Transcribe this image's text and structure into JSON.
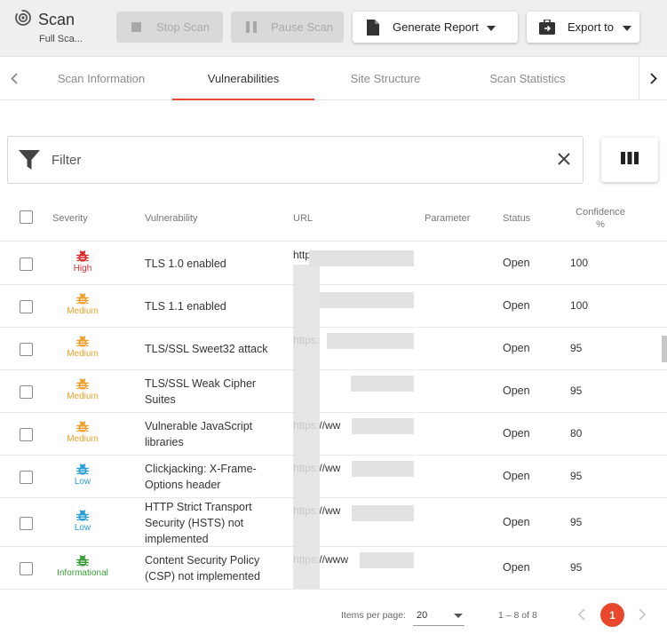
{
  "header": {
    "title": "Scan",
    "subtitle": "Full Sca...",
    "buttons": {
      "stop": "Stop Scan",
      "pause": "Pause Scan",
      "report": "Generate Report",
      "export": "Export to"
    }
  },
  "tabs": [
    "Scan Information",
    "Vulnerabilities",
    "Site Structure",
    "Scan Statistics"
  ],
  "active_tab": "Vulnerabilities",
  "filter": {
    "label": "Filter"
  },
  "table": {
    "headers": {
      "severity": "Severity",
      "vulnerability": "Vulnerability",
      "url": "URL",
      "parameter": "Parameter",
      "status": "Status",
      "confidence": "Confidence %"
    },
    "rows": [
      {
        "severity": "High",
        "color": "#d92b2b",
        "vulnerability": "TLS 1.0 enabled",
        "url": "https://w",
        "status": "Open",
        "confidence": "100"
      },
      {
        "severity": "Medium",
        "color": "#f0a030",
        "vulnerability": "TLS 1.1 enabled",
        "url": "",
        "status": "Open",
        "confidence": "100"
      },
      {
        "severity": "Medium",
        "color": "#f0a030",
        "vulnerability": "TLS/SSL Sweet32 attack",
        "url": "https:",
        "status": "Open",
        "confidence": "95"
      },
      {
        "severity": "Medium",
        "color": "#f0a030",
        "vulnerability": "TLS/SSL Weak Cipher Suites",
        "url": "",
        "status": "Open",
        "confidence": "95"
      },
      {
        "severity": "Medium",
        "color": "#f0a030",
        "vulnerability": "Vulnerable JavaScript libraries",
        "url": "https://ww",
        "status": "Open",
        "confidence": "80"
      },
      {
        "severity": "Low",
        "color": "#2a9fd8",
        "vulnerability": "Clickjacking: X-Frame-Options header",
        "url": "https://ww",
        "status": "Open",
        "confidence": "95"
      },
      {
        "severity": "Low",
        "color": "#2a9fd8",
        "vulnerability": "HTTP Strict Transport Security (HSTS) not implemented",
        "url": "https://ww",
        "status": "Open",
        "confidence": "95"
      },
      {
        "severity": "Informational",
        "color": "#3a9e3a",
        "vulnerability": "Content Security Policy (CSP) not implemented",
        "url": "https://www",
        "status": "Open",
        "confidence": "95"
      }
    ]
  },
  "pagination": {
    "items_per_page_label": "Items per page:",
    "items_per_page": "20",
    "range": "1 – 8 of 8",
    "current_page": "1"
  },
  "colors": {
    "accent": "#e8472b"
  }
}
